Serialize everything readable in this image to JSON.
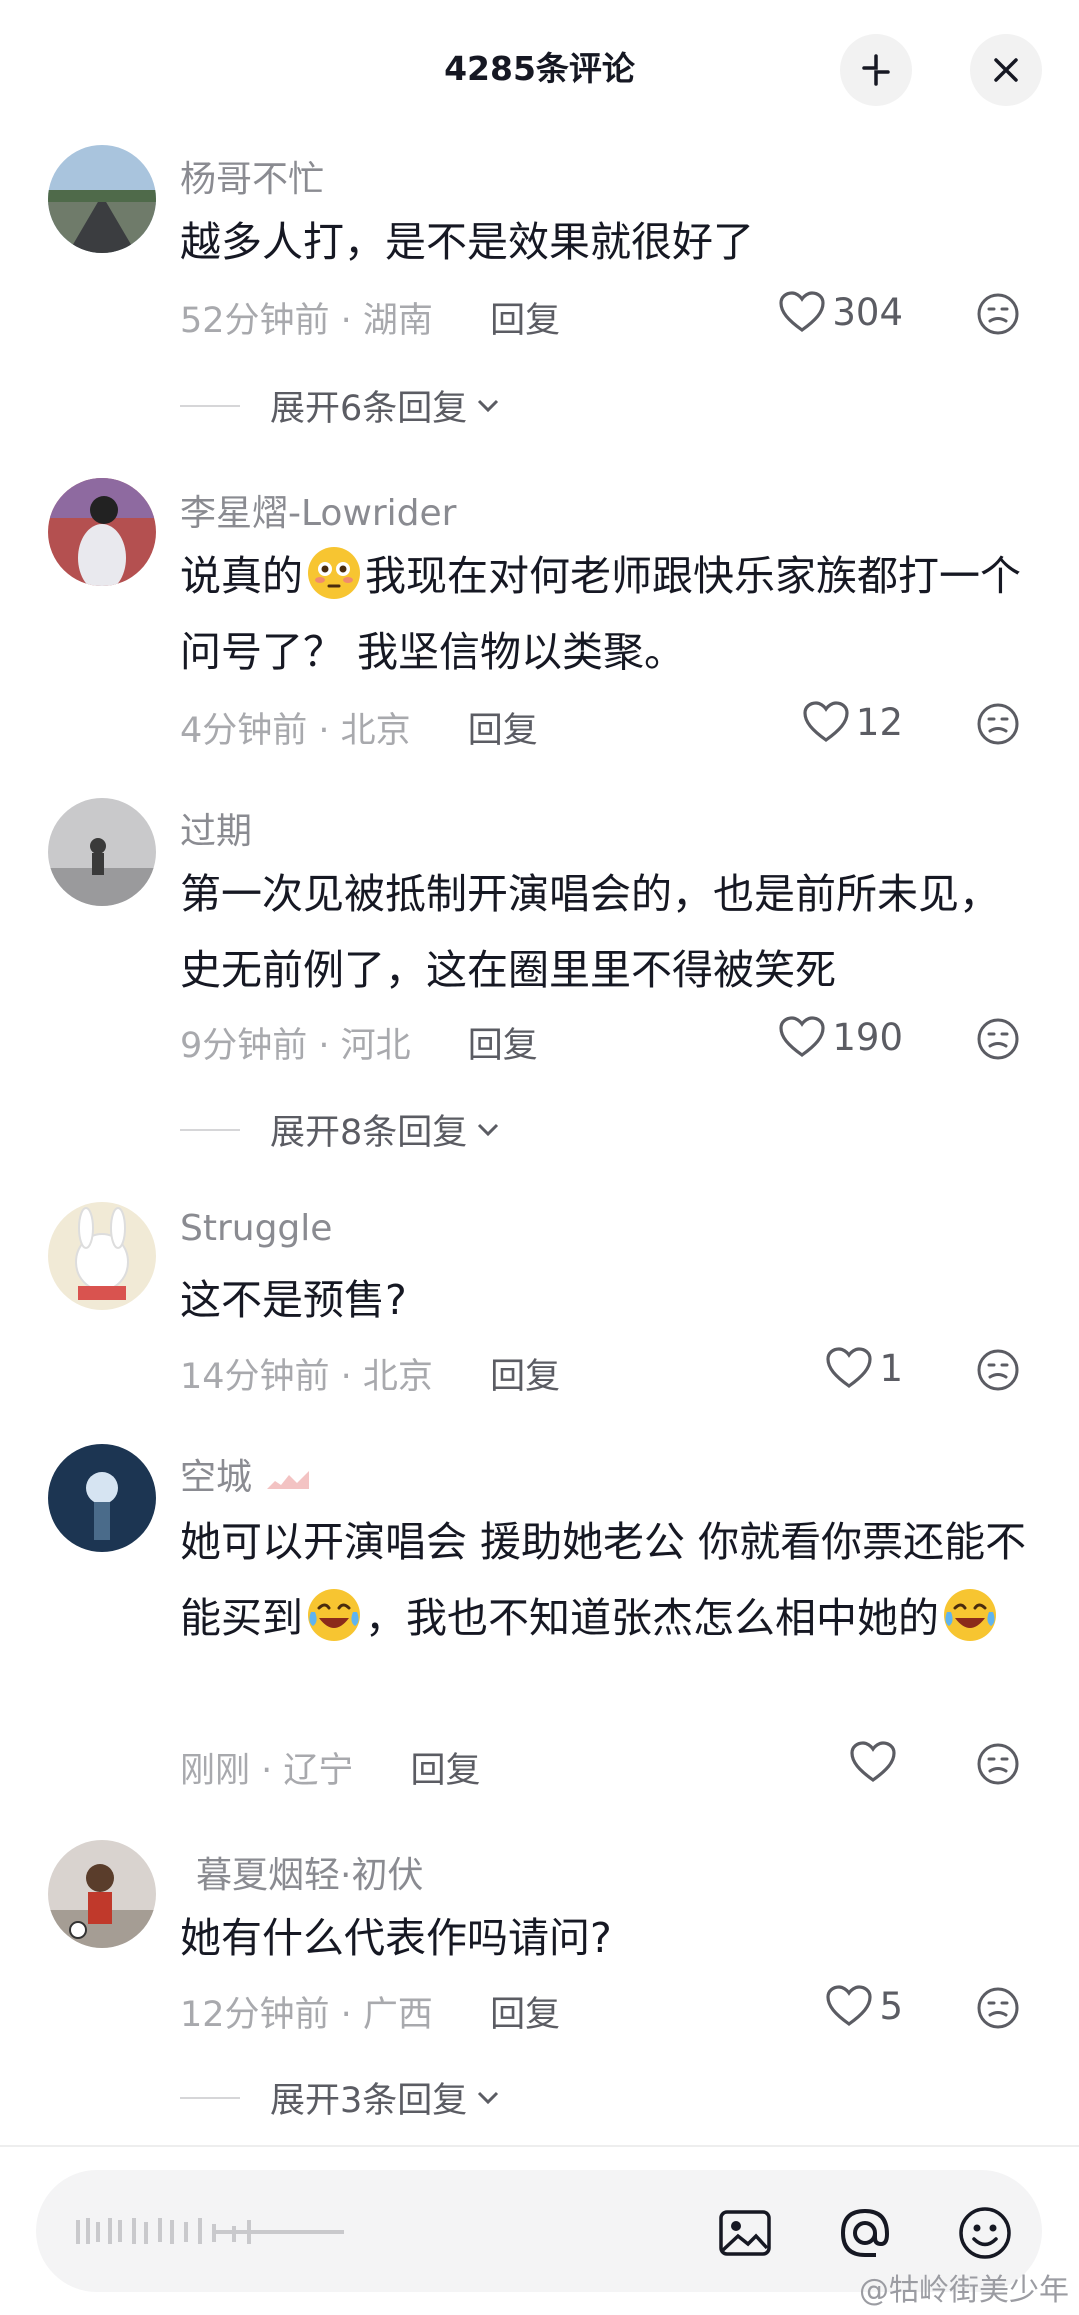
{
  "header": {
    "title": "4285条评论",
    "collapse_icon": "collapse-arrows-icon",
    "close_icon": "close-icon"
  },
  "comments": [
    {
      "username": "杨哥不忙",
      "text": "越多人打，是不是效果就很好了",
      "time_location": "52分钟前 · 湖南",
      "reply_label": "回复",
      "likes": "304",
      "expand_label": "展开6条回复"
    },
    {
      "username": "李星熠-Lowrider",
      "text_before_emoji": "说真的",
      "text_after_emoji": "我现在对何老师跟快乐家族都打一个问号了？ 我坚信物以类聚。",
      "time_location": "4分钟前 · 北京",
      "reply_label": "回复",
      "likes": "12"
    },
    {
      "username": "过期",
      "text": "第一次见被抵制开演唱会的，也是前所未见，史无前例了，这在圈里里不得被笑死",
      "time_location": "9分钟前 · 河北",
      "reply_label": "回复",
      "likes": "190",
      "expand_label": "展开8条回复"
    },
    {
      "username": "Struggle",
      "text": "这不是预售?",
      "time_location": "14分钟前 · 北京",
      "reply_label": "回复",
      "likes": "1"
    },
    {
      "username": "空城",
      "text_part1": "她可以开演唱会 援助她老公  你就看你票还能不能买到",
      "text_part2": "，我也不知道张杰怎么相中她的",
      "time_location": "刚刚 · 辽宁",
      "reply_label": "回复",
      "likes": ""
    },
    {
      "username": "暮夏烟轻·初伏",
      "text": "她有什么代表作吗请问?",
      "time_location": "12分钟前 · 广西",
      "reply_label": "回复",
      "likes": "5",
      "expand_label": "展开3条回复"
    }
  ],
  "input_bar": {
    "image_icon": "image-icon",
    "mention_icon": "at-mention-icon",
    "emoji_icon": "emoji-smile-icon"
  },
  "watermark": "@牯岭街美少年",
  "colors": {
    "text_primary": "#161823",
    "text_secondary": "#8a8b91",
    "meta": "#a8a9ad"
  }
}
